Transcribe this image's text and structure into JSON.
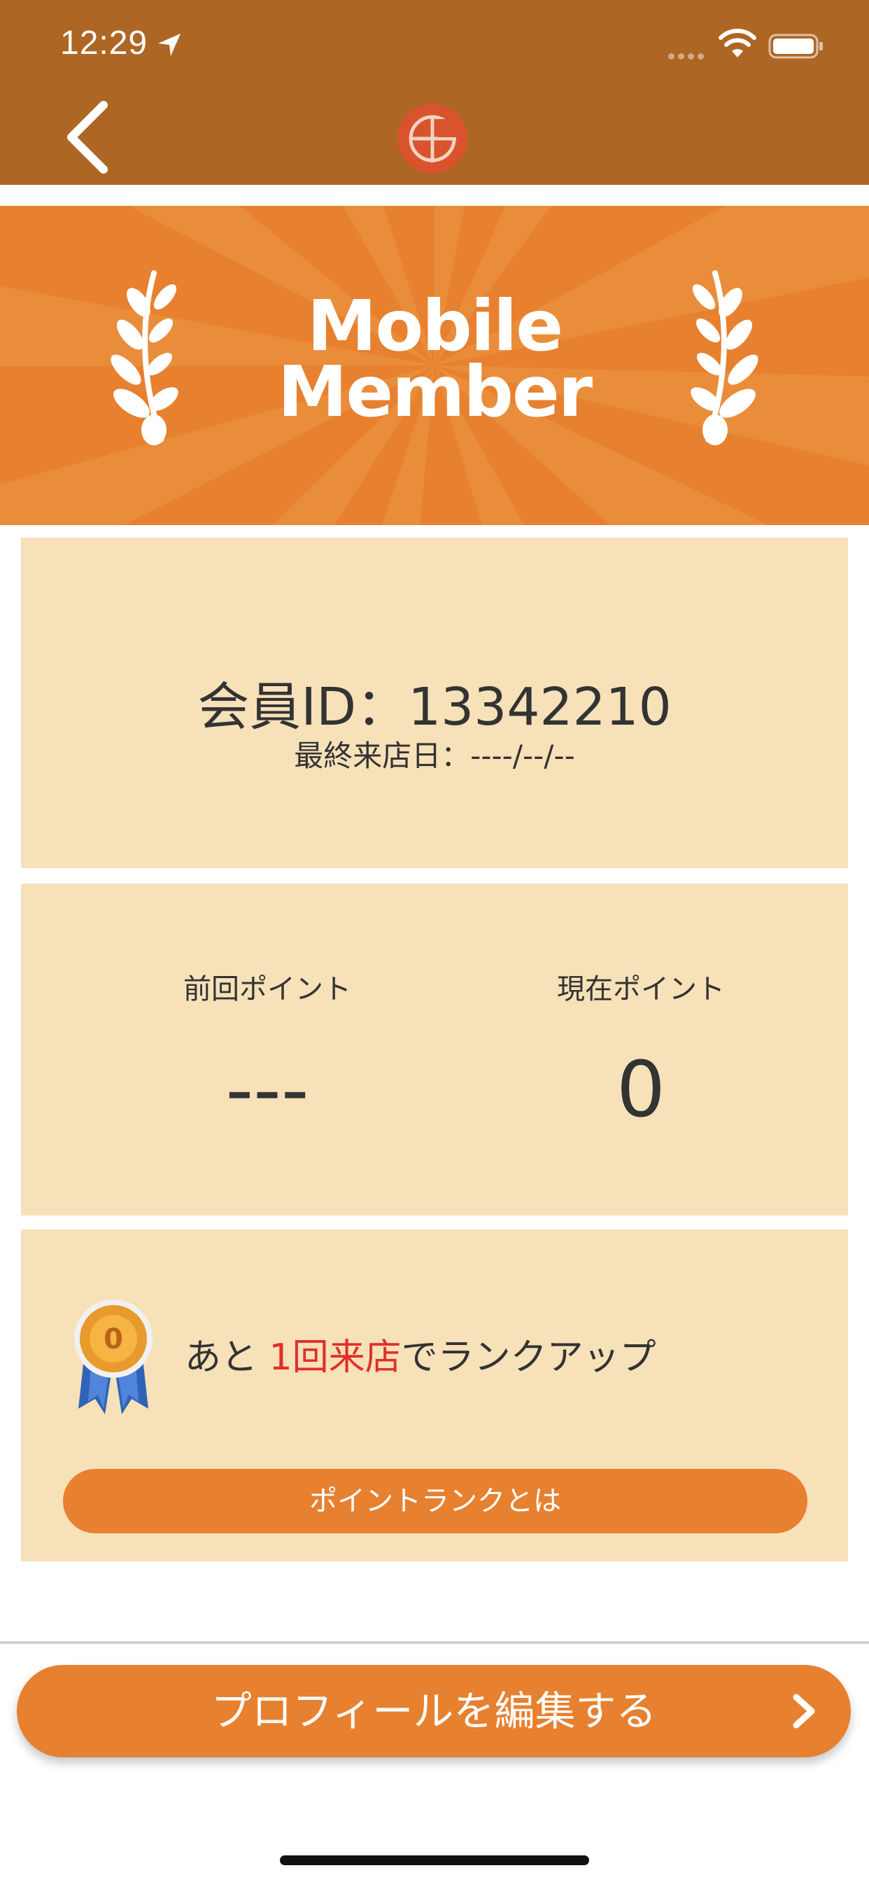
{
  "status_bar": {
    "time": "12:29"
  },
  "nav": {
    "back_icon": "chevron-left-icon",
    "logo": "brand-logo"
  },
  "hero": {
    "title_line1": "Mobile",
    "title_line2": "Member"
  },
  "member": {
    "id_text": "会員ID：13342210",
    "last_visit_text": "最終来店日：----/--/--"
  },
  "points": {
    "previous_label": "前回ポイント",
    "previous_value": "---",
    "current_label": "現在ポイント",
    "current_value": "0"
  },
  "rank": {
    "prefix": "あと ",
    "highlight": "1回来店",
    "suffix": "でランクアップ",
    "button_label": "ポイントランクとは",
    "medal_text": "0"
  },
  "footer": {
    "edit_profile_label": "プロフィールを編集する"
  },
  "colors": {
    "nav_bg": "#ad6624",
    "accent": "#e7802f",
    "card_bg": "#f7e1b9",
    "highlight": "#e0302a"
  }
}
